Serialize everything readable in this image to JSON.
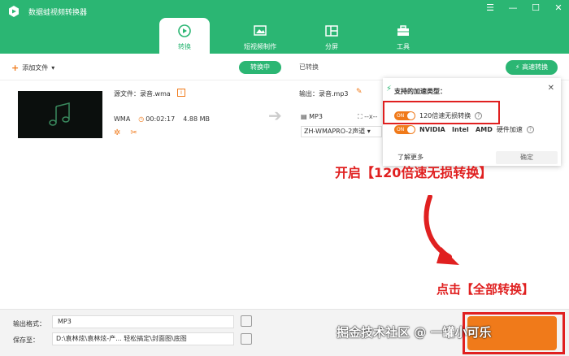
{
  "app": {
    "title": "数据蛙视频转换器"
  },
  "colors": {
    "brand_green": "#2bb673",
    "accent_orange": "#f07a1a",
    "annotation_red": "#e02020"
  },
  "window_controls": [
    "menu-icon",
    "minimize-icon",
    "maximize-icon",
    "close-icon"
  ],
  "nav": {
    "tabs": [
      {
        "label": "转换",
        "icon": "convert-icon",
        "active": true
      },
      {
        "label": "短视频制作",
        "icon": "video-maker-icon",
        "active": false
      },
      {
        "label": "分屏",
        "icon": "split-screen-icon",
        "active": false
      },
      {
        "label": "工具",
        "icon": "toolbox-icon",
        "active": false
      }
    ]
  },
  "toolbar": {
    "add_file": "添加文件",
    "seg_converting": "转换中",
    "seg_converted": "已转换",
    "accel": "高速转换"
  },
  "file": {
    "source": "源文件：录音.wma",
    "format": "WMA",
    "duration": "00:02:17",
    "size": "4.88 MB",
    "output": "输出：录音.mp3",
    "out_format": "MP3",
    "out_size": "--x--",
    "audio_track": "ZH-WMAPRO-2声道"
  },
  "popup": {
    "title": "支持的加速类型：",
    "opt1": "120倍速无损转换",
    "opt2": "NVIDIA   Intel   AMD",
    "opt2_suffix": "硬件加速",
    "toggle_text": "ON",
    "link": "了解更多",
    "ok": "确定"
  },
  "annotations": {
    "top": "开启【120倍速无损转换】",
    "bottom": "点击【全部转换】"
  },
  "bottom": {
    "format_label": "输出格式：",
    "format_value": "MP3",
    "save_label": "保存至：",
    "save_value": "D:\\袁林炫\\袁林炫-产...  轻松搞定\\封面图\\底图"
  },
  "watermark": "掘金技术社区 @ 一罐小可乐"
}
